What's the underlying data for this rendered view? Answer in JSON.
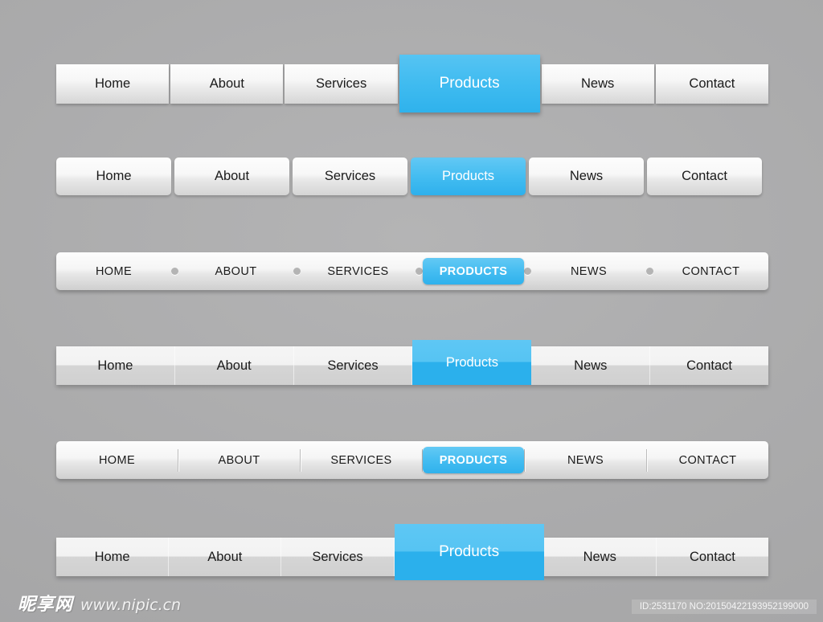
{
  "background": {
    "base_color": "#ababac",
    "accent_blue": "#3fbbf0"
  },
  "navbars": [
    {
      "style": "squared-tiles",
      "items": [
        {
          "label": "Home",
          "active": false
        },
        {
          "label": "About",
          "active": false
        },
        {
          "label": "Services",
          "active": false
        },
        {
          "label": "Products",
          "active": true
        },
        {
          "label": "News",
          "active": false
        },
        {
          "label": "Contact",
          "active": false
        }
      ]
    },
    {
      "style": "rounded-buttons",
      "items": [
        {
          "label": "Home",
          "active": false
        },
        {
          "label": "About",
          "active": false
        },
        {
          "label": "Services",
          "active": false
        },
        {
          "label": "Products",
          "active": true
        },
        {
          "label": "News",
          "active": false
        },
        {
          "label": "Contact",
          "active": false
        }
      ]
    },
    {
      "style": "bar-dot-separators",
      "items": [
        {
          "label": "HOME",
          "active": false
        },
        {
          "label": "ABOUT",
          "active": false
        },
        {
          "label": "SERVICES",
          "active": false
        },
        {
          "label": "PRODUCTS",
          "active": true
        },
        {
          "label": "NEWS",
          "active": false
        },
        {
          "label": "CONTACT",
          "active": false
        }
      ]
    },
    {
      "style": "flat-bar",
      "items": [
        {
          "label": "Home",
          "active": false
        },
        {
          "label": "About",
          "active": false
        },
        {
          "label": "Services",
          "active": false
        },
        {
          "label": "Products",
          "active": true
        },
        {
          "label": "News",
          "active": false
        },
        {
          "label": "Contact",
          "active": false
        }
      ]
    },
    {
      "style": "bar-line-separators",
      "items": [
        {
          "label": "HOME",
          "active": false
        },
        {
          "label": "ABOUT",
          "active": false
        },
        {
          "label": "SERVICES",
          "active": false
        },
        {
          "label": "PRODUCTS",
          "active": true
        },
        {
          "label": "NEWS",
          "active": false
        },
        {
          "label": "CONTACT",
          "active": false
        }
      ]
    },
    {
      "style": "flat-bar-tall-active",
      "items": [
        {
          "label": "Home",
          "active": false
        },
        {
          "label": "About",
          "active": false
        },
        {
          "label": "Services",
          "active": false
        },
        {
          "label": "Products",
          "active": true
        },
        {
          "label": "News",
          "active": false
        },
        {
          "label": "Contact",
          "active": false
        }
      ]
    }
  ],
  "footer": {
    "watermark_cn": "昵享网",
    "watermark_url": "www.nipic.cn",
    "id_text": "ID:2531170 NO:20150422193952199000"
  }
}
